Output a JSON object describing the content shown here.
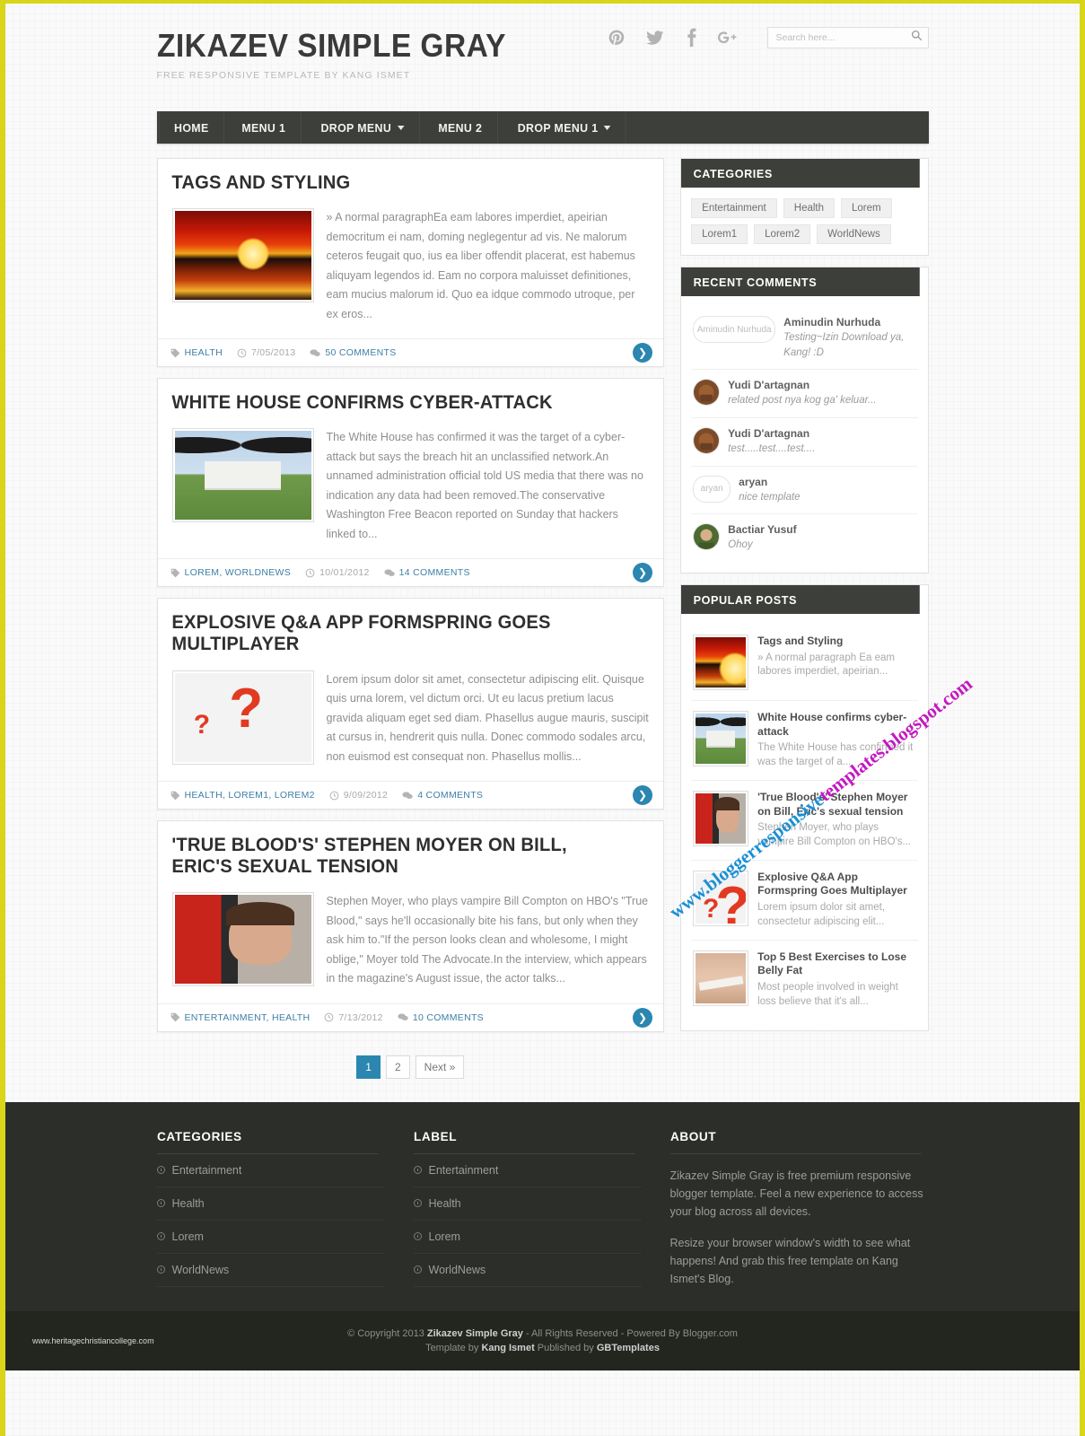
{
  "site": {
    "title": "Zikazev Simple Gray",
    "tagline": "Free responsive template by Kang Ismet"
  },
  "search": {
    "placeholder": "Search here...",
    "value": ""
  },
  "social": [
    {
      "name": "pinterest-icon",
      "label": "Pinterest"
    },
    {
      "name": "twitter-icon",
      "label": "Twitter"
    },
    {
      "name": "facebook-icon",
      "label": "Facebook"
    },
    {
      "name": "googleplus-icon",
      "label": "Google Plus"
    }
  ],
  "nav": [
    {
      "label": "Home",
      "dropdown": false
    },
    {
      "label": "Menu 1",
      "dropdown": false
    },
    {
      "label": "Drop Menu",
      "dropdown": true
    },
    {
      "label": "Menu 2",
      "dropdown": false
    },
    {
      "label": "Drop Menu 1",
      "dropdown": true
    }
  ],
  "posts": [
    {
      "title": "Tags and Styling",
      "excerpt": "» A normal paragraphEa eam labores imperdiet, apeirian democritum ei nam, doming neglegentur ad vis. Ne malorum ceteros feugait quo, ius ea liber offendit placerat, est habemus aliquyam legendos id. Eam no corpora maluisset definitiones, eam mucius malorum id. Quo ea idque commodo utroque, per ex eros...",
      "labels": "Health",
      "date": "7/05/2013",
      "comments": "50 Comments",
      "art": "art-sunset"
    },
    {
      "title": "White House confirms cyber-attack",
      "excerpt": "The White House has confirmed it was the target of a cyber-attack but says the breach hit an unclassified network.An unnamed administration official told US media that there was no indication any data had been removed.The conservative Washington Free Beacon reported on Sunday that hackers linked to...",
      "labels": "Lorem, WorldNews",
      "date": "10/01/2012",
      "comments": "14 Comments",
      "art": "art-whitehouse"
    },
    {
      "title": "Explosive Q&A App Formspring Goes Multiplayer",
      "excerpt": "Lorem ipsum dolor sit amet, consectetur adipiscing elit. Quisque quis urna lorem, vel dictum orci. Ut eu lacus pretium lacus gravida aliquam eget sed diam. Phasellus augue mauris, suscipit at cursus in, hendrerit quis nulla. Donec commodo sodales arcu, non euismod est consequat non. Phasellus mollis...",
      "labels": "Health, Lorem1, Lorem2",
      "date": "9/09/2012",
      "comments": "4 Comments",
      "art": "art-question"
    },
    {
      "title": "'True Blood's' Stephen Moyer on Bill, Eric's sexual tension",
      "excerpt": "Stephen Moyer, who plays vampire Bill Compton on HBO's \"True Blood,\" says he'll occasionally bite his fans, but only when they ask him to.\"If the person looks clean and wholesome, I might oblige,\" Moyer told The Advocate.In the interview, which appears in the magazine's August issue, the actor talks...",
      "labels": "Entertainment, Health",
      "date": "7/13/2012",
      "comments": "10 Comments",
      "art": "art-moyer"
    }
  ],
  "pagination": [
    {
      "label": "1",
      "active": true
    },
    {
      "label": "2",
      "active": false
    },
    {
      "label": "Next »",
      "active": false
    }
  ],
  "sidebar": {
    "categories": {
      "title": "Categories",
      "tags": [
        "Entertainment",
        "Health",
        "Lorem",
        "Lorem1",
        "Lorem2",
        "WorldNews"
      ]
    },
    "recent_comments": {
      "title": "Recent Comments",
      "items": [
        {
          "name": "Aminudin Nurhuda",
          "message": "Testing~Izin Download ya, Kang! :D",
          "avatar_alt": "Aminudin Nurhuda",
          "broken": true
        },
        {
          "name": "Yudi D'artagnan",
          "message": "related post nya kog ga' keluar...",
          "avatar_alt": "",
          "broken": false
        },
        {
          "name": "Yudi D'artagnan",
          "message": "test.....test....test....",
          "avatar_alt": "",
          "broken": false
        },
        {
          "name": "aryan",
          "message": "nice template",
          "avatar_alt": "aryan",
          "broken": true
        },
        {
          "name": "Bactiar Yusuf",
          "message": "Ohoy",
          "avatar_alt": "",
          "broken": false
        }
      ]
    },
    "popular_posts": {
      "title": "Popular Posts",
      "items": [
        {
          "title": "Tags and Styling",
          "snippet": "» A normal paragraph Ea eam labores imperdiet, apeirian...",
          "art": "art-sunset"
        },
        {
          "title": "White House confirms cyber-attack",
          "snippet": "The White House has confirmed it was the target of a...",
          "art": "art-whitehouse"
        },
        {
          "title": "'True Blood's' Stephen Moyer on Bill, Eric's sexual tension",
          "snippet": "Stephen Moyer, who plays vampire Bill Compton on HBO's...",
          "art": "art-moyer"
        },
        {
          "title": "Explosive Q&A App Formspring Goes Multiplayer",
          "snippet": "Lorem ipsum dolor sit amet, consectetur adipiscing elit...",
          "art": "art-question"
        },
        {
          "title": "Top 5 Best Exercises to Lose Belly Fat",
          "snippet": "Most people involved in weight loss believe that it's all...",
          "art": "art-belly"
        }
      ]
    }
  },
  "footer": {
    "categories": {
      "title": "Categories",
      "items": [
        "Entertainment",
        "Health",
        "Lorem",
        "WorldNews"
      ]
    },
    "label": {
      "title": "Label",
      "items": [
        "Entertainment",
        "Health",
        "Lorem",
        "WorldNews"
      ]
    },
    "about": {
      "title": "About",
      "paragraph1": "Zikazev Simple Gray is free premium responsive blogger template. Feel a new experience to access your blog across all devices.",
      "paragraph2": "Resize your browser window's width to see what happens! And grab this free template on Kang Ismet's Blog."
    }
  },
  "bottom": {
    "site_url": "www.heritagechristiancollege.com",
    "copyright_pre": "© Copyright 2013 ",
    "copyright_brand": "Zikazev Simple Gray",
    "copyright_post": " - All Rights Reserved - Powered By Blogger.com",
    "credit_pre": "Template by ",
    "credit_author": "Kang Ismet",
    "credit_mid": " Published by ",
    "credit_publisher": "GBTemplates"
  },
  "watermark": {
    "part1": "www.bloggerresponsive",
    "part2": "templates.blogspot.com"
  },
  "colors": {
    "accent": "#2b86b0",
    "nav_bg": "#3c3f3a",
    "footer_bg": "#2b2e29",
    "border_frame": "#d8d51a"
  }
}
